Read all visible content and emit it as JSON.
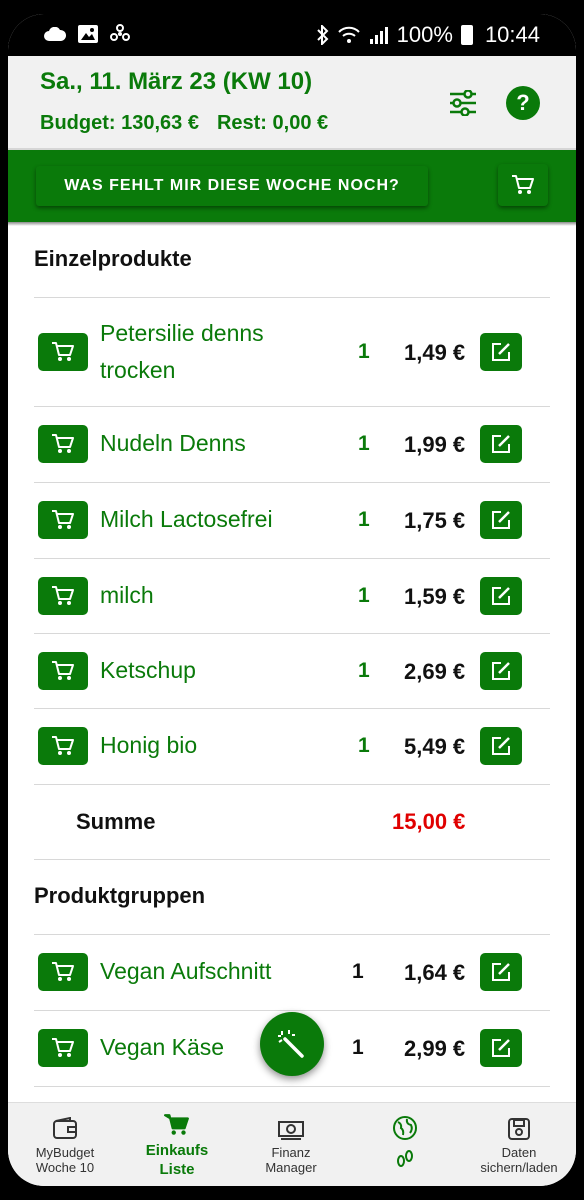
{
  "status_bar": {
    "battery": "100%",
    "time": "10:44"
  },
  "header": {
    "date": "Sa., 11. März 23 (KW 10)",
    "budget": "Budget: 130,63 €",
    "rest": "Rest: 0,00 €",
    "help_label": "?"
  },
  "banner": {
    "button_label": "WAS FEHLT MIR DIESE WOCHE NOCH?"
  },
  "einzelprodukte": {
    "title": "Einzelprodukte",
    "items": [
      {
        "name_line1": "Petersilie denns",
        "name_line2": "trocken",
        "qty": "1",
        "price": "1,49 €"
      },
      {
        "name": "Nudeln Denns",
        "qty": "1",
        "price": "1,99 €"
      },
      {
        "name": "Milch Lactosefrei",
        "qty": "1",
        "price": "1,75 €"
      },
      {
        "name": "milch",
        "qty": "1",
        "price": "1,59 €"
      },
      {
        "name": "Ketschup",
        "qty": "1",
        "price": "2,69 €"
      },
      {
        "name": "Honig bio",
        "qty": "1",
        "price": "5,49 €"
      }
    ],
    "sum_label": "Summe",
    "sum_value": "15,00 €"
  },
  "produktgruppen": {
    "title": "Produktgruppen",
    "items": [
      {
        "name": "Vegan Aufschnitt",
        "qty": "1",
        "price": "1,64 €"
      },
      {
        "name": "Vegan Käse",
        "qty": "1",
        "price": "2,99 €"
      }
    ]
  },
  "bottom_nav": {
    "items": [
      {
        "label1": "MyBudget",
        "label2": "Woche 10",
        "icon": "wallet-icon"
      },
      {
        "label1": "Einkaufs",
        "label2": "Liste",
        "icon": "cart-icon"
      },
      {
        "label1": "Finanz",
        "label2": "Manager",
        "icon": "money-icon"
      },
      {
        "label1": "",
        "label2": "",
        "icon": "globe-footprint-icon"
      },
      {
        "label1": "Daten",
        "label2": "sichern/laden",
        "icon": "floppy-icon"
      }
    ]
  },
  "colors": {
    "primary": "#0a7a0a",
    "sum": "#e00000"
  }
}
